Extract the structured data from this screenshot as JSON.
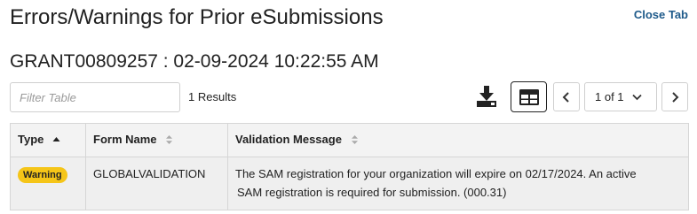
{
  "header": {
    "title": "Errors/Warnings for Prior eSubmissions",
    "close_label": "Close Tab"
  },
  "submission": {
    "heading": "GRANT00809257  :  02-09-2024 10:22:55 AM"
  },
  "toolbar": {
    "filter_placeholder": "Filter Table",
    "results_text": "1 Results",
    "download_icon": "download-icon",
    "table_view_icon": "table-view-icon"
  },
  "pager": {
    "prev_icon": "chevron-left-icon",
    "page_label": "1 of 1",
    "next_icon": "chevron-right-icon"
  },
  "table": {
    "columns": [
      {
        "label": "Type",
        "sort": "ascending"
      },
      {
        "label": "Form Name",
        "sort": "none"
      },
      {
        "label": "Validation Message",
        "sort": "none"
      }
    ],
    "rows": [
      {
        "type": "Warning",
        "form_name": "GLOBALVALIDATION",
        "message_line1": "The SAM registration for your organization will expire on 02/17/2024. An active",
        "message_line2": "SAM registration is required for submission.  (000.31)"
      }
    ]
  },
  "colors": {
    "link": "#1e5a8a",
    "warning_badge": "#f5c518",
    "header_bg": "#f3f3f3",
    "row_bg": "#efefef"
  }
}
